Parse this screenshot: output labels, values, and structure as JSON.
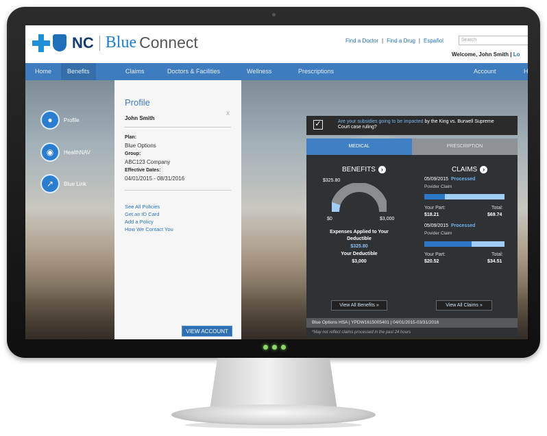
{
  "header": {
    "logo_nc": "NC",
    "logo_blue": "Blue",
    "logo_connect": "Connect",
    "links": [
      "Find a Doctor",
      "Find a Drug",
      "Español"
    ],
    "separator": "|",
    "search_placeholder": "Search",
    "welcome": "Welcome, John Smith",
    "login_fragment": "Lo"
  },
  "nav": {
    "items": [
      "Home",
      "Benefits",
      "Claims",
      "Doctors & Facilities",
      "Wellness",
      "Prescriptions",
      "Account",
      "H"
    ]
  },
  "sidebar": {
    "items": [
      {
        "label": "Profile",
        "icon": "user-icon"
      },
      {
        "label": "HealthNAV",
        "icon": "location-pin-icon"
      },
      {
        "label": "Blue Link",
        "icon": "link-icon"
      }
    ]
  },
  "profile": {
    "title": "Profile",
    "close": "x",
    "name": "John Smith",
    "plan_label": "Plan:",
    "plan": "Blue Options",
    "group_label": "Group:",
    "group": "ABC123 Company",
    "dates_label": "Effective Dates:",
    "dates": "04/01/2015 - 08/31/2016",
    "links": [
      "See All Policies",
      "Get an ID Card",
      "Add a Policy",
      "How We Contact You"
    ],
    "view_button": "VIEW ACCOUNT"
  },
  "notice": {
    "text_a": "Are your subsidies going to be impacted",
    "text_b": " by the King vs. Burwell Supreme Court case ruling?"
  },
  "tabs": {
    "medical": "MEDICAL",
    "prescription": "PRESCRIPTION"
  },
  "benefits": {
    "heading": "BENEFITS",
    "spent": "$325.80",
    "min": "$0",
    "max": "$3,000",
    "gauge_fraction": 0.1086,
    "applied_label_1": "Expenses Applied to Your",
    "applied_label_2": "Deductible",
    "applied_value": "$325.80",
    "deductible_label": "Your Deductible",
    "deductible_value": "$3,000",
    "view_all": "View All Benefits  »"
  },
  "claims": {
    "heading": "CLAIMS",
    "items": [
      {
        "date": "05/09/2015",
        "status": "Processed",
        "type": "Povider Claim",
        "part_label": "Your Part:",
        "total_label": "Total:",
        "part": "$18.21",
        "total": "$69.74",
        "fraction": 0.26
      },
      {
        "date": "05/09/2015",
        "status": "Processed",
        "type": "Povider Claim",
        "part_label": "Your Part:",
        "total_label": "Total:",
        "part": "$20.52",
        "total": "$34.51",
        "fraction": 0.59
      }
    ],
    "view_all": "View All Claims  »"
  },
  "plan_bar": "Blue Options HSA | YPDW1615005401 | 04/01/2015-03/31/2016",
  "footnote": "*May not reflect claims processed in the past 24 hours",
  "colors": {
    "brand_blue": "#3e7cc0",
    "accent_blue": "#1f7fd1",
    "processed": "#6fb1f0",
    "card_bg": "#2f3234"
  }
}
